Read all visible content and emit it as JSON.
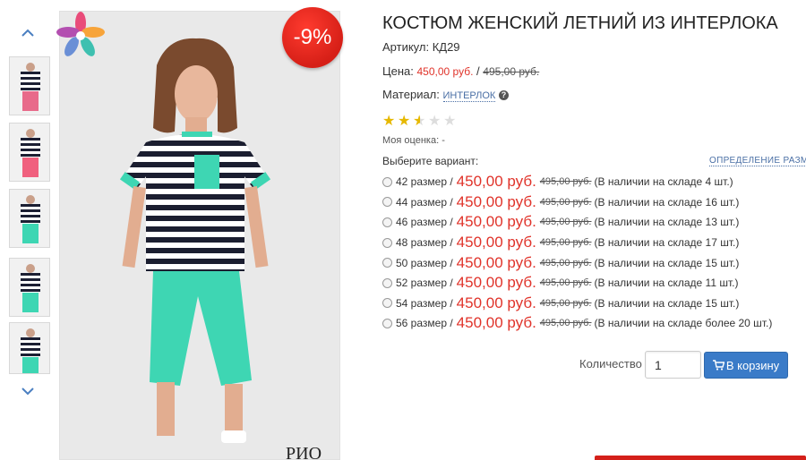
{
  "product": {
    "title": "КОСТЮМ ЖЕНСКИЙ ЛЕТНИЙ ИЗ ИНТЕРЛОКА",
    "sku_label": "Артикул:",
    "sku": "КД29",
    "price_label": "Цена:",
    "price": "450,00 руб.",
    "price_sep": "/",
    "old_price": "495,00 руб.",
    "material_label": "Материал:",
    "material": "ИНТЕРЛОК",
    "rating": 2.5,
    "rating_max": 5,
    "my_rating": "Моя оценка: -",
    "discount": "-9%"
  },
  "variants_section": {
    "label": "Выберите вариант:",
    "size_link": "ОПРЕДЕЛЕНИЕ РАЗМЕРА"
  },
  "variants": [
    {
      "size": "42 размер /",
      "price": "450,00 руб.",
      "old": "495,00 руб.",
      "stock": "(В наличии на складе 4 шт.)"
    },
    {
      "size": "44 размер /",
      "price": "450,00 руб.",
      "old": "495,00 руб.",
      "stock": "(В наличии на складе 16 шт.)"
    },
    {
      "size": "46 размер /",
      "price": "450,00 руб.",
      "old": "495,00 руб.",
      "stock": "(В наличии на складе 13 шт.)"
    },
    {
      "size": "48 размер /",
      "price": "450,00 руб.",
      "old": "495,00 руб.",
      "stock": "(В наличии на складе 17 шт.)"
    },
    {
      "size": "50 размер /",
      "price": "450,00 руб.",
      "old": "495,00 руб.",
      "stock": "(В наличии на складе 15 шт.)"
    },
    {
      "size": "52 размер /",
      "price": "450,00 руб.",
      "old": "495,00 руб.",
      "stock": "(В наличии на складе 11 шт.)"
    },
    {
      "size": "54 размер /",
      "price": "450,00 руб.",
      "old": "495,00 руб.",
      "stock": "(В наличии на складе 15 шт.)"
    },
    {
      "size": "56 размер /",
      "price": "450,00 руб.",
      "old": "495,00 руб.",
      "stock": "(В наличии на складе более 20 шт.)"
    }
  ],
  "purchase": {
    "qty_label": "Количество",
    "qty_value": "1",
    "cart_label": "В корзину"
  },
  "gallery": {
    "up_icon": "chevron-up-icon",
    "down_icon": "chevron-down-icon",
    "thumbnail_count": 5,
    "watermark": "РИО"
  },
  "colors": {
    "price_red": "#e0332a",
    "link_blue": "#4a6fa5",
    "button_blue": "#3a7bc8",
    "badge_red": "#d61f17",
    "star_gold": "#e6b800",
    "mint": "#3ed6b3"
  }
}
